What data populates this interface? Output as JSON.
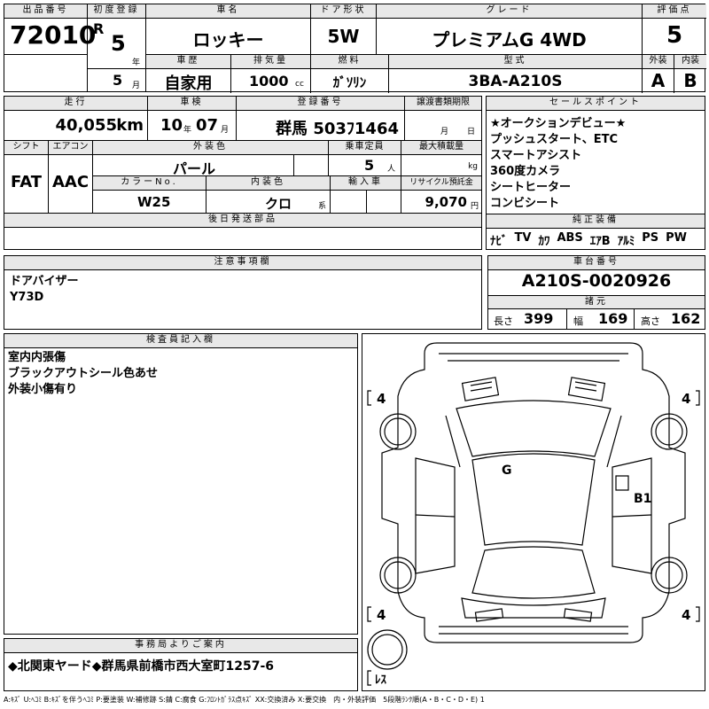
{
  "top": {
    "lot_no_label": "出品番号",
    "lot_no": "72010",
    "first_reg_label": "初度登録",
    "era": "R",
    "first_reg_year": "5",
    "year_unit": "年",
    "first_reg_month": "5",
    "month_unit": "月",
    "car_name_label": "車名",
    "car_name": "ロッキー",
    "door_label": "ドア形状",
    "door": "5W",
    "grade_label": "グレード",
    "grade": "プレミアムG 4WD",
    "score_label": "評価点",
    "score": "5",
    "history_label": "車歴",
    "history": "自家用",
    "displacement_label": "排気量",
    "displacement": "1000",
    "cc_unit": "cc",
    "fuel_label": "燃料",
    "fuel": "ｶﾞｿﾘﾝ",
    "model_label": "型式",
    "model": "3BA-A210S",
    "exterior_label": "外装",
    "exterior": "A",
    "interior_label": "内装",
    "interior": "B"
  },
  "row2": {
    "mileage_label": "走行",
    "mileage": "40,055",
    "km_unit": "km",
    "inspection_label": "車検",
    "inspection_year": "10",
    "inspection_month": "07",
    "year_unit": "年",
    "month_unit": "月",
    "plate_label": "登録番号",
    "plate": "群馬 503ﾌ1464",
    "transfer_label": "譲渡書類期限",
    "transfer_month_unit": "月",
    "transfer_day_unit": "日",
    "shift_label": "シフト",
    "shift": "FAT",
    "aircon_label": "エアコン",
    "aircon": "AAC",
    "color_label": "外装色",
    "color": "パール",
    "capacity_label": "乗車定員",
    "capacity": "5",
    "capacity_unit": "人",
    "load_label": "最大積載量",
    "load_unit": "kg",
    "color_no_label": "カラーNo.",
    "color_no": "W25",
    "int_color_label": "内装色",
    "int_color": "クロ",
    "int_color_unit": "系",
    "import_label": "輸入車",
    "recycle_label": "リサイクル預託金",
    "recycle": "9,070",
    "recycle_unit": "円",
    "later_parts_label": "後日発送部品"
  },
  "sales": {
    "label": "セールスポイント",
    "lines": [
      "★オークションデビュー★",
      "プッシュスタート、ETC",
      "スマートアシスト",
      "360度カメラ",
      "シートヒーター",
      "コンビシート"
    ],
    "equipment_label": "純正装備",
    "equipment": [
      "ﾅﾋﾞ",
      "TV",
      "ｶﾜ",
      "ABS",
      "ｴｱB",
      "ｱﾙﾐ",
      "PS",
      "PW"
    ]
  },
  "notes": {
    "label": "注意事項欄",
    "lines": [
      "ドアバイザー",
      "Y73D"
    ]
  },
  "chassis": {
    "label": "車台番号",
    "value": "A210S-0020926",
    "spec_label": "諸元",
    "length_label": "長さ",
    "length": "399",
    "width_label": "幅",
    "width": "169",
    "height_label": "高さ",
    "height": "162"
  },
  "inspector": {
    "label": "検査員記入欄",
    "lines": [
      "室内内張傷",
      "ブラックアウトシール色あせ",
      "外装小傷有り"
    ]
  },
  "diagram": {
    "tire_fl": "4",
    "tire_fr": "4",
    "tire_rl": "4",
    "tire_rr": "4",
    "spare": "ﾚｽ",
    "mark_g": "G",
    "mark_b1": "B1"
  },
  "office": {
    "label": "事務局よりご案内",
    "text": "◆北関東ヤード◆群馬県前橋市西大室町1257-6"
  },
  "legend": "A:ｷｽﾞ U:ﾍｺﾐ B:ｷｽﾞを伴うﾍｺﾐ P:要塗装 W:補修跡 S:錆 C:腐食 G:ﾌﾛﾝﾄｶﾞﾗｽ点ｷｽﾞ XX:交換済み X:要交換　内・外装評価　5段階ﾗﾝｸ順(A・B・C・D・E) 1"
}
